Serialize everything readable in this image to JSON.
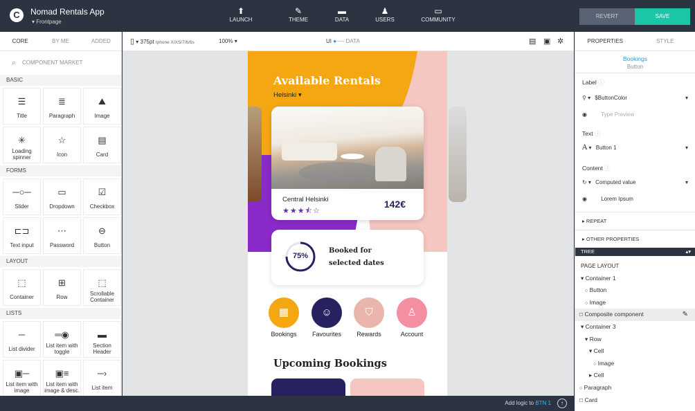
{
  "header": {
    "app_name": "Nomad Rentals App",
    "page": "Frontpage",
    "nav": [
      {
        "label": "LAUNCH",
        "icon": "rocket-icon"
      },
      {
        "label": "THEME",
        "icon": "brush-icon"
      },
      {
        "label": "DATA",
        "icon": "folder-icon"
      },
      {
        "label": "USERS",
        "icon": "users-icon"
      },
      {
        "label": "COMMUNITY",
        "icon": "chat-icon"
      }
    ],
    "revert_label": "REVERT",
    "save_label": "SAVE",
    "save_color": "#1bc6a6"
  },
  "left": {
    "tabs": [
      "CORE",
      "BY ME",
      "ADDED"
    ],
    "search_placeholder": "COMPONENT MARKET",
    "sections": [
      {
        "title": "BASIC",
        "items": [
          {
            "label": "Title",
            "icon": "title-icon"
          },
          {
            "label": "Paragraph",
            "icon": "paragraph-icon"
          },
          {
            "label": "Image",
            "icon": "image-icon"
          },
          {
            "label": "Loading spinner",
            "icon": "spinner-icon"
          },
          {
            "label": "Icon",
            "icon": "star-icon"
          },
          {
            "label": "Card",
            "icon": "card-icon"
          }
        ]
      },
      {
        "title": "FORMS",
        "items": [
          {
            "label": "Slider",
            "icon": "slider-icon"
          },
          {
            "label": "Dropdown",
            "icon": "dropdown-icon"
          },
          {
            "label": "Checkbox",
            "icon": "checkbox-icon"
          },
          {
            "label": "Text input",
            "icon": "text-input-icon"
          },
          {
            "label": "Password",
            "icon": "password-icon"
          },
          {
            "label": "Button",
            "icon": "button-icon"
          }
        ]
      },
      {
        "title": "LAYOUT",
        "items": [
          {
            "label": "Container",
            "icon": "container-icon"
          },
          {
            "label": "Row",
            "icon": "row-icon"
          },
          {
            "label": "Scrollable Container",
            "icon": "scrollable-container-icon"
          }
        ]
      },
      {
        "title": "LISTS",
        "items": [
          {
            "label": "List divider",
            "icon": "list-divider-icon"
          },
          {
            "label": "List item with toggle",
            "icon": "list-toggle-icon"
          },
          {
            "label": "Section Header",
            "icon": "section-header-icon"
          },
          {
            "label": "List item with image",
            "icon": "list-image-icon"
          },
          {
            "label": "List item with image & desc.",
            "icon": "list-image-desc-icon"
          },
          {
            "label": "List item",
            "icon": "list-item-icon"
          }
        ]
      }
    ]
  },
  "toolbar": {
    "device_size": "375pt",
    "device_name": "Iphone X/XS/7/6/6s",
    "zoom": "100%",
    "ui_label": "UI",
    "data_label": "DATA"
  },
  "phone": {
    "heading": "Available Rentals",
    "city": "Helsinki",
    "listing_name": "Central Helsinki",
    "price": "142€",
    "rating": 3.5,
    "booked_percent": "75%",
    "booked_text_1": "Booked for",
    "booked_text_2": "selected dates",
    "actions": [
      {
        "label": "Bookings",
        "color": "#f5a712",
        "icon": "calendar-icon"
      },
      {
        "label": "Favourites",
        "color": "#27215f",
        "icon": "smiley-icon"
      },
      {
        "label": "Rewards",
        "color": "#eab5ad",
        "icon": "shield-icon"
      },
      {
        "label": "Account",
        "color": "#f48ea1",
        "icon": "person-icon"
      }
    ],
    "upcoming_heading": "Upcoming Bookings",
    "accent_orange": "#f5a712",
    "accent_purple": "#8a2bc9",
    "accent_pink": "#f5c6c2",
    "accent_navy": "#27215f"
  },
  "bottom": {
    "logic_text": "Add logic to",
    "logic_target": "BTN 1"
  },
  "right": {
    "tabs": [
      "PROPERTIES",
      "STYLE"
    ],
    "component_name": "Bookings",
    "component_type": "Button",
    "label_title": "Label",
    "label_value": "$ButtonColor",
    "type_preview_placeholder": "Type Preview",
    "text_title": "Text",
    "text_value": "Button 1",
    "content_title": "Content",
    "content_value": "Computed value",
    "content_preview": "Lorem Ipsum",
    "repeat_label": "REPEAT",
    "other_label": "OTHER PROPERTIES",
    "tree_title": "TREE",
    "tree": [
      {
        "label": "PAGE LAYOUT",
        "prefix": ""
      },
      {
        "label": "Container 1",
        "prefix": "▾"
      },
      {
        "label": "Button",
        "prefix": "○"
      },
      {
        "label": "Image",
        "prefix": "○"
      },
      {
        "label": "Composite component",
        "prefix": "□"
      },
      {
        "label": "Container 3",
        "prefix": "▾"
      },
      {
        "label": "Row",
        "prefix": "▾"
      },
      {
        "label": "Cell",
        "prefix": "▾"
      },
      {
        "label": "Image",
        "prefix": "○"
      },
      {
        "label": "Cell",
        "prefix": "▸"
      },
      {
        "label": "Paragraph",
        "prefix": "○"
      },
      {
        "label": "Card",
        "prefix": "□"
      }
    ]
  }
}
